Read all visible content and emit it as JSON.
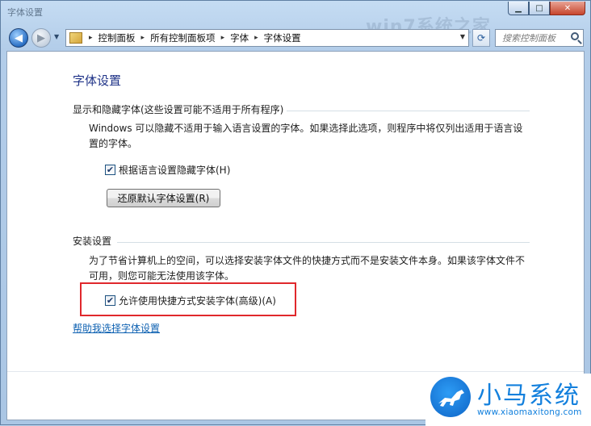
{
  "window": {
    "title": "字体设置",
    "watermark_title": "win7系统之家"
  },
  "caption_buttons": {
    "minimize": "▁",
    "maximize": "□",
    "close": "✕"
  },
  "address_bar": {
    "breadcrumbs": [
      "控制面板",
      "所有控制面板项",
      "字体",
      "字体设置"
    ],
    "separator": "▸"
  },
  "search": {
    "placeholder": "搜索控制面板"
  },
  "page": {
    "title": "字体设置",
    "hide_section": {
      "heading": "显示和隐藏字体(这些设置可能不适用于所有程序)",
      "description": "Windows 可以隐藏不适用于输入语言设置的字体。如果选择此选项，则程序中将仅列出适用于语言设置的字体。",
      "checkbox_label": "根据语言设置隐藏字体(H)",
      "checkbox_checked": true,
      "restore_button": "还原默认字体设置(R)"
    },
    "install_section": {
      "heading": "安装设置",
      "description": "为了节省计算机上的空间，可以选择安装字体文件的快捷方式而不是安装文件本身。如果该字体文件不可用，则您可能无法使用该字体。",
      "checkbox_label": "允许使用快捷方式安装字体(高级)(A)",
      "checkbox_checked": true
    },
    "help_link": "帮助我选择字体设置"
  },
  "brand": {
    "name": "小马系统",
    "url": "www.xiaomaxitong.com",
    "color": "#1380dd"
  }
}
